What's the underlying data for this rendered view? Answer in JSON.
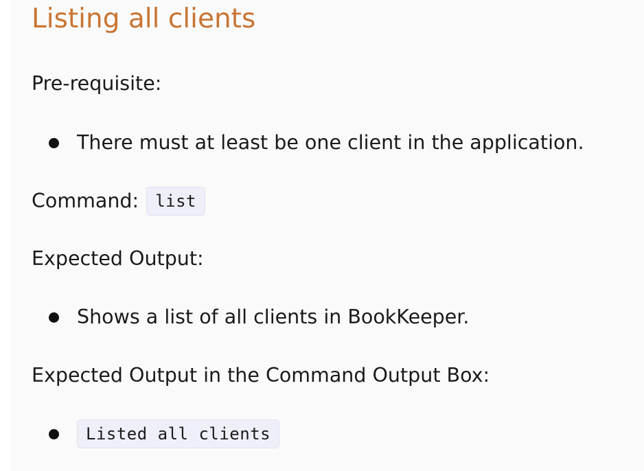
{
  "colors": {
    "heading": "#c87533",
    "panel_background": "#fafafa",
    "code_background": "#efeffa",
    "text": "#1a1a1a"
  },
  "section": {
    "title": "Listing all clients",
    "prerequisite_label": "Pre-requisite:",
    "prerequisites": [
      "There must at least be one client in the application."
    ],
    "command_label": "Command:",
    "command": "list",
    "expected_output_label": "Expected Output:",
    "expected_outputs": [
      "Shows a list of all clients in BookKeeper."
    ],
    "expected_box_label": "Expected Output in the Command Output Box:",
    "expected_box_outputs": [
      "Listed all clients"
    ]
  }
}
